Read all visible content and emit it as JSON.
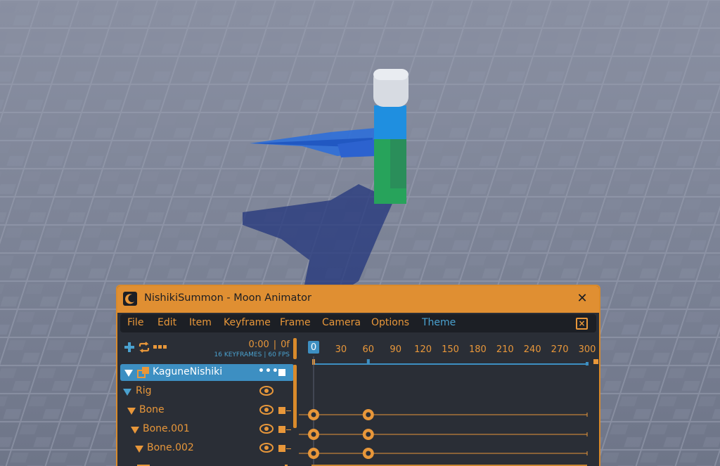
{
  "window": {
    "title": "NishikiSummon - Moon Animator"
  },
  "menu": {
    "items": [
      "File",
      "Edit",
      "Item",
      "Keyframe",
      "Frame",
      "Camera",
      "Options",
      "Theme"
    ]
  },
  "toolbar": {
    "time": "0:00",
    "frame": "0f",
    "keyframes": "16 KEYFRAMES",
    "fps": "60 FPS",
    "icons": [
      "plus-icon",
      "loop-icon",
      "more-icon"
    ]
  },
  "timeline": {
    "current_frame": "0",
    "ruler": [
      "30",
      "60",
      "90",
      "120",
      "150",
      "180",
      "210",
      "240",
      "270",
      "300"
    ],
    "ruler_values": [
      30,
      60,
      90,
      120,
      150,
      180,
      210,
      240,
      270,
      300
    ],
    "max_frame": 300
  },
  "tracks": [
    {
      "label": "KaguneNishiki",
      "depth": 0,
      "selected": true,
      "keyframes": []
    },
    {
      "label": "Rig",
      "depth": 1,
      "selected": false,
      "keyframes": []
    },
    {
      "label": "Bone",
      "depth": 2,
      "selected": false,
      "keyframes": [
        0,
        60
      ]
    },
    {
      "label": "Bone.001",
      "depth": 3,
      "selected": false,
      "keyframes": [
        0,
        60
      ]
    },
    {
      "label": "Bone.002",
      "depth": 4,
      "selected": false,
      "keyframes": [
        0,
        60
      ]
    }
  ],
  "colors": {
    "accent": "#e08f32",
    "panel": "#2a2e36",
    "menubar": "#1c1f25",
    "blue": "#4aa1cf",
    "selected_row": "#3d8fc2"
  }
}
